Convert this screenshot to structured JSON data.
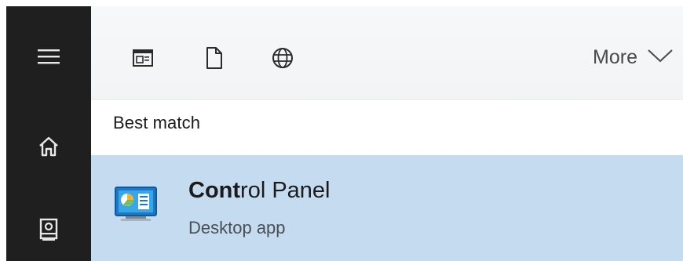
{
  "sidebar": {
    "items": [
      {
        "icon": "hamburger-menu-icon"
      },
      {
        "icon": "home-icon"
      },
      {
        "icon": "device-icon"
      }
    ]
  },
  "toolbar": {
    "filters": [
      {
        "icon": "apps-filter-icon"
      },
      {
        "icon": "documents-filter-icon"
      },
      {
        "icon": "web-filter-icon"
      }
    ],
    "more_label": "More",
    "more_icon": "chevron-down-icon"
  },
  "results": {
    "section_title": "Best match",
    "items": [
      {
        "title_match": "Cont",
        "title_rest": "rol Panel",
        "subtitle": "Desktop app",
        "icon": "control-panel-icon"
      }
    ]
  },
  "colors": {
    "sidebar": "#1f1f1f",
    "selected_row": "#c5dcf0",
    "toolbar": "#f3f4f5"
  }
}
